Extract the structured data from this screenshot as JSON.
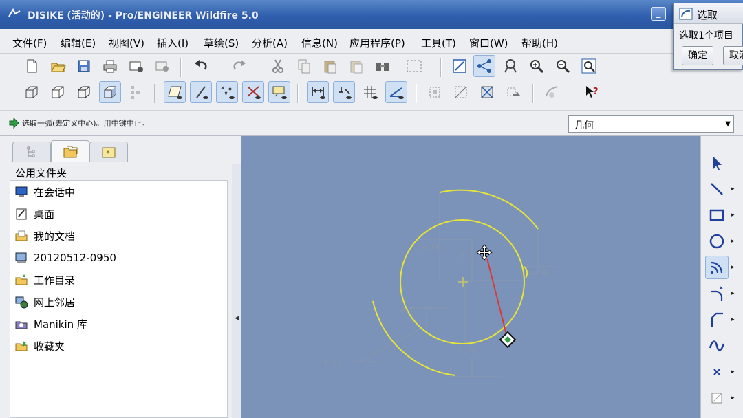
{
  "window": {
    "title": "DISIKE (活动的) - Pro/ENGINEER Wildfire 5.0",
    "buttons": {
      "minimize": "_",
      "maximize": "□",
      "close": "×"
    }
  },
  "menubar": {
    "items": [
      "文件(F)",
      "编辑(E)",
      "视图(V)",
      "插入(I)",
      "草绘(S)",
      "分析(A)",
      "信息(N)",
      "应用程序(P)",
      "工具(T)",
      "窗口(W)",
      "帮助(H)"
    ]
  },
  "toolbar": {
    "row1_icons": [
      "new-icon",
      "open-icon",
      "save-icon",
      "print-icon",
      "email-icon",
      "email-link-icon",
      "undo-icon",
      "redo-icon",
      "cut-icon",
      "copy-icon",
      "paste-icon",
      "paste-special-icon",
      "find-icon",
      "select-box-icon",
      "sketch-view-icon",
      "sketch-display-icon",
      "datum-display-icon",
      "zoom-in-icon",
      "zoom-out-icon",
      "refit-icon"
    ],
    "row2_icons": [
      "wireframe-icon",
      "hidden-line-icon",
      "no-hidden-icon",
      "shading-icon",
      "saved-views-icon",
      "datum-plane-icon",
      "datum-axis-icon",
      "datum-point-icon",
      "datum-csys-icon",
      "annotation-icon",
      "dimension-icon",
      "constraint-icon",
      "grid-icon",
      "vertex-icon",
      "orient-icon",
      "section-icon",
      "intersect-icon",
      "mirror-icon",
      "model-icon",
      "whats-this-icon"
    ]
  },
  "status": {
    "message": "选取一弧(去定义中心)。用中键中止。",
    "filter_value": "几何"
  },
  "navigator": {
    "header": "公用文件夹",
    "items": [
      {
        "label": "在会话中",
        "icon": "session-icon"
      },
      {
        "label": "桌面",
        "icon": "desktop-icon"
      },
      {
        "label": "我的文档",
        "icon": "my-documents-icon"
      },
      {
        "label": "20120512-0950",
        "icon": "computer-icon"
      },
      {
        "label": "工作目录",
        "icon": "working-directory-icon"
      },
      {
        "label": "网上邻居",
        "icon": "network-icon"
      },
      {
        "label": "Manikin 库",
        "icon": "manikin-library-icon"
      },
      {
        "label": "收藏夹",
        "icon": "favorites-icon"
      }
    ]
  },
  "graphics": {
    "dimensions": [
      "6.98",
      "3",
      "4.0",
      "1.80",
      "7.28",
      "5.0"
    ]
  },
  "sketch_tools": [
    "select-arrow-icon",
    "line-icon",
    "rectangle-icon",
    "circle-icon",
    "arc-icon",
    "fillet-icon",
    "chamfer-icon",
    "spline-icon",
    "point-icon",
    "offset-icon"
  ],
  "dialog": {
    "title": "选取",
    "message": "选取1个项目",
    "ok_label": "确定",
    "cancel_label": "取消"
  }
}
